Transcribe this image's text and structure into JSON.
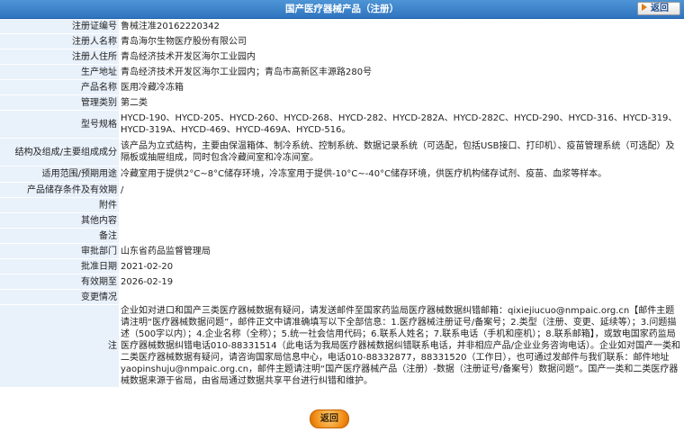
{
  "header": {
    "title": "国产医疗器械产品（注册）",
    "back_label": "返回"
  },
  "fields": [
    {
      "label": "注册证编号",
      "value": "鲁械注准20162220342"
    },
    {
      "label": "注册人名称",
      "value": "青岛海尔生物医疗股份有限公司"
    },
    {
      "label": "注册人住所",
      "value": "青岛经济技术开发区海尔工业园内"
    },
    {
      "label": "生产地址",
      "value": "青岛经济技术开发区海尔工业园内；青岛市高新区丰源路280号"
    },
    {
      "label": "产品名称",
      "value": "医用冷藏冷冻箱"
    },
    {
      "label": "管理类别",
      "value": "第二类"
    },
    {
      "label": "型号规格",
      "value": "HYCD-190、HYCD-205、HYCD-260、HYCD-268、HYCD-282、HYCD-282A、HYCD-282C、HYCD-290、HYCD-316、HYCD-319、HYCD-319A、HYCD-469、HYCD-469A、HYCD-516。"
    },
    {
      "label": "结构及组成/主要组成成分",
      "value": "该产品为立式结构，主要由保温箱体、制冷系统、控制系统、数据记录系统（可选配，包括USB接口、打印机）、疫苗管理系统（可选配）及隔板或抽屉组成，同时包含冷藏间室和冷冻间室。"
    },
    {
      "label": "适用范围/预期用途",
      "value": "冷藏室用于提供2°C~8°C储存环境，冷冻室用于提供-10°C~-40°C储存环境，供医疗机构储存试剂、疫苗、血浆等样本。"
    },
    {
      "label": "产品储存条件及有效期",
      "value": "/"
    },
    {
      "label": "附件",
      "value": ""
    },
    {
      "label": "其他内容",
      "value": ""
    },
    {
      "label": "备注",
      "value": ""
    },
    {
      "label": "审批部门",
      "value": "山东省药品监督管理局"
    },
    {
      "label": "批准日期",
      "value": "2021-02-20"
    },
    {
      "label": "有效期至",
      "value": "2026-02-19"
    },
    {
      "label": "变更情况",
      "value": ""
    }
  ],
  "note": {
    "label": "注",
    "text": "企业如对进口和国产三类医疗器械数据有疑问，请发送邮件至国家药监局医疗器械数据纠错邮箱：qixiejiucuo@nmpaic.org.cn【邮件主题请注明“医疗器械数据问题”，邮件正文中请准确填写以下全部信息：1.医疗器械注册证号/备案号；2.类型（注册、变更、延续等）；3.问题描述（500字以内）；4.企业名称（全称）；5.统一社会信用代码；6.联系人姓名；7.联系电话（手机和座机）；8.联系邮箱】，或致电国家药监局医疗器械数据纠错电话010-88331514（此电话为我局医疗器械数据纠错联系电话，并非相应产品/企业业务咨询电话）。企业如对国产一类和二类医疗器械数据有疑问，请咨询国家局信息中心，电话010-88332877，88331520（工作日），也可通过发邮件与我们联系：邮件地址yaopinshuju@nmpaic.org.cn，邮件主题请注明“国产医疗器械产品（注册）-数据（注册证号/备案号）数据问题”。国产一类和二类医疗器械数据来源于省局，由省局通过数据共享平台进行纠错和维护。"
  },
  "footer": {
    "back_label": "返回"
  }
}
